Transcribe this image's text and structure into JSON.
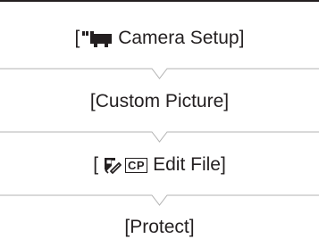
{
  "steps": [
    {
      "open": "[",
      "icon": "camera-menu-icon",
      "label": " Camera Setup",
      "close": "]"
    },
    {
      "open": "[",
      "label": "Custom Picture",
      "close": "]"
    },
    {
      "open": "[",
      "icon": "custom-picture-icon",
      "badge": "CP",
      "label": "Edit File",
      "close": "]"
    },
    {
      "open": "[",
      "label": "Protect",
      "close": "]"
    }
  ],
  "colors": {
    "text": "#231f20",
    "rule": "#b3b3b3",
    "background": "#ffffff"
  }
}
